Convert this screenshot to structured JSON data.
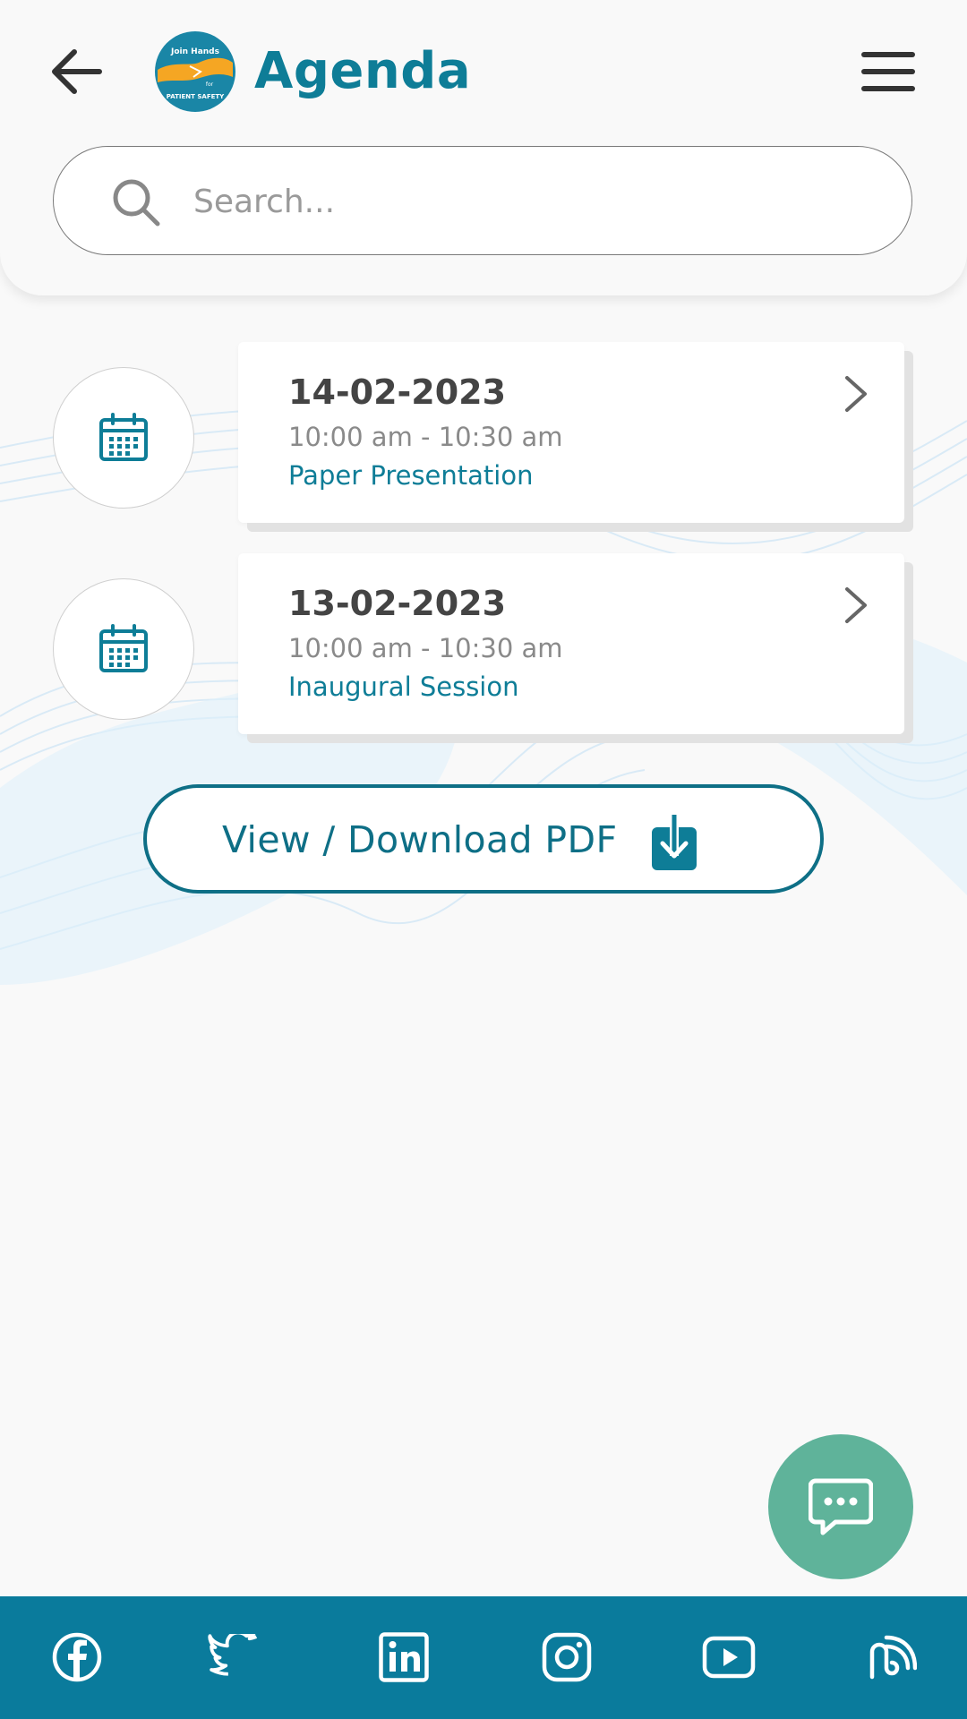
{
  "header": {
    "title": "Agenda",
    "logo_icon": "join-hands-patient-safety-logo",
    "logo_text_top": "Join Hands",
    "logo_text_mid": "for",
    "logo_text_bottom": "PATIENT SAFETY"
  },
  "search": {
    "placeholder": "Search...",
    "value": ""
  },
  "agenda": {
    "items": [
      {
        "date": "14-02-2023",
        "time": "10:00 am - 10:30 am",
        "name": "Paper Presentation"
      },
      {
        "date": "13-02-2023",
        "time": "10:00 am - 10:30 am",
        "name": "Inaugural Session"
      }
    ]
  },
  "pdf_button": {
    "label": "View / Download PDF"
  },
  "footer": {
    "icons": [
      "facebook-icon",
      "twitter-icon",
      "linkedin-icon",
      "instagram-icon",
      "youtube-icon",
      "blog-icon"
    ]
  },
  "colors": {
    "primary": "#0e7d97",
    "footer": "#0a7b9c",
    "chat_fab": "#5fb39a",
    "logo_orange": "#f5a623",
    "logo_blue": "#1a86a6"
  }
}
